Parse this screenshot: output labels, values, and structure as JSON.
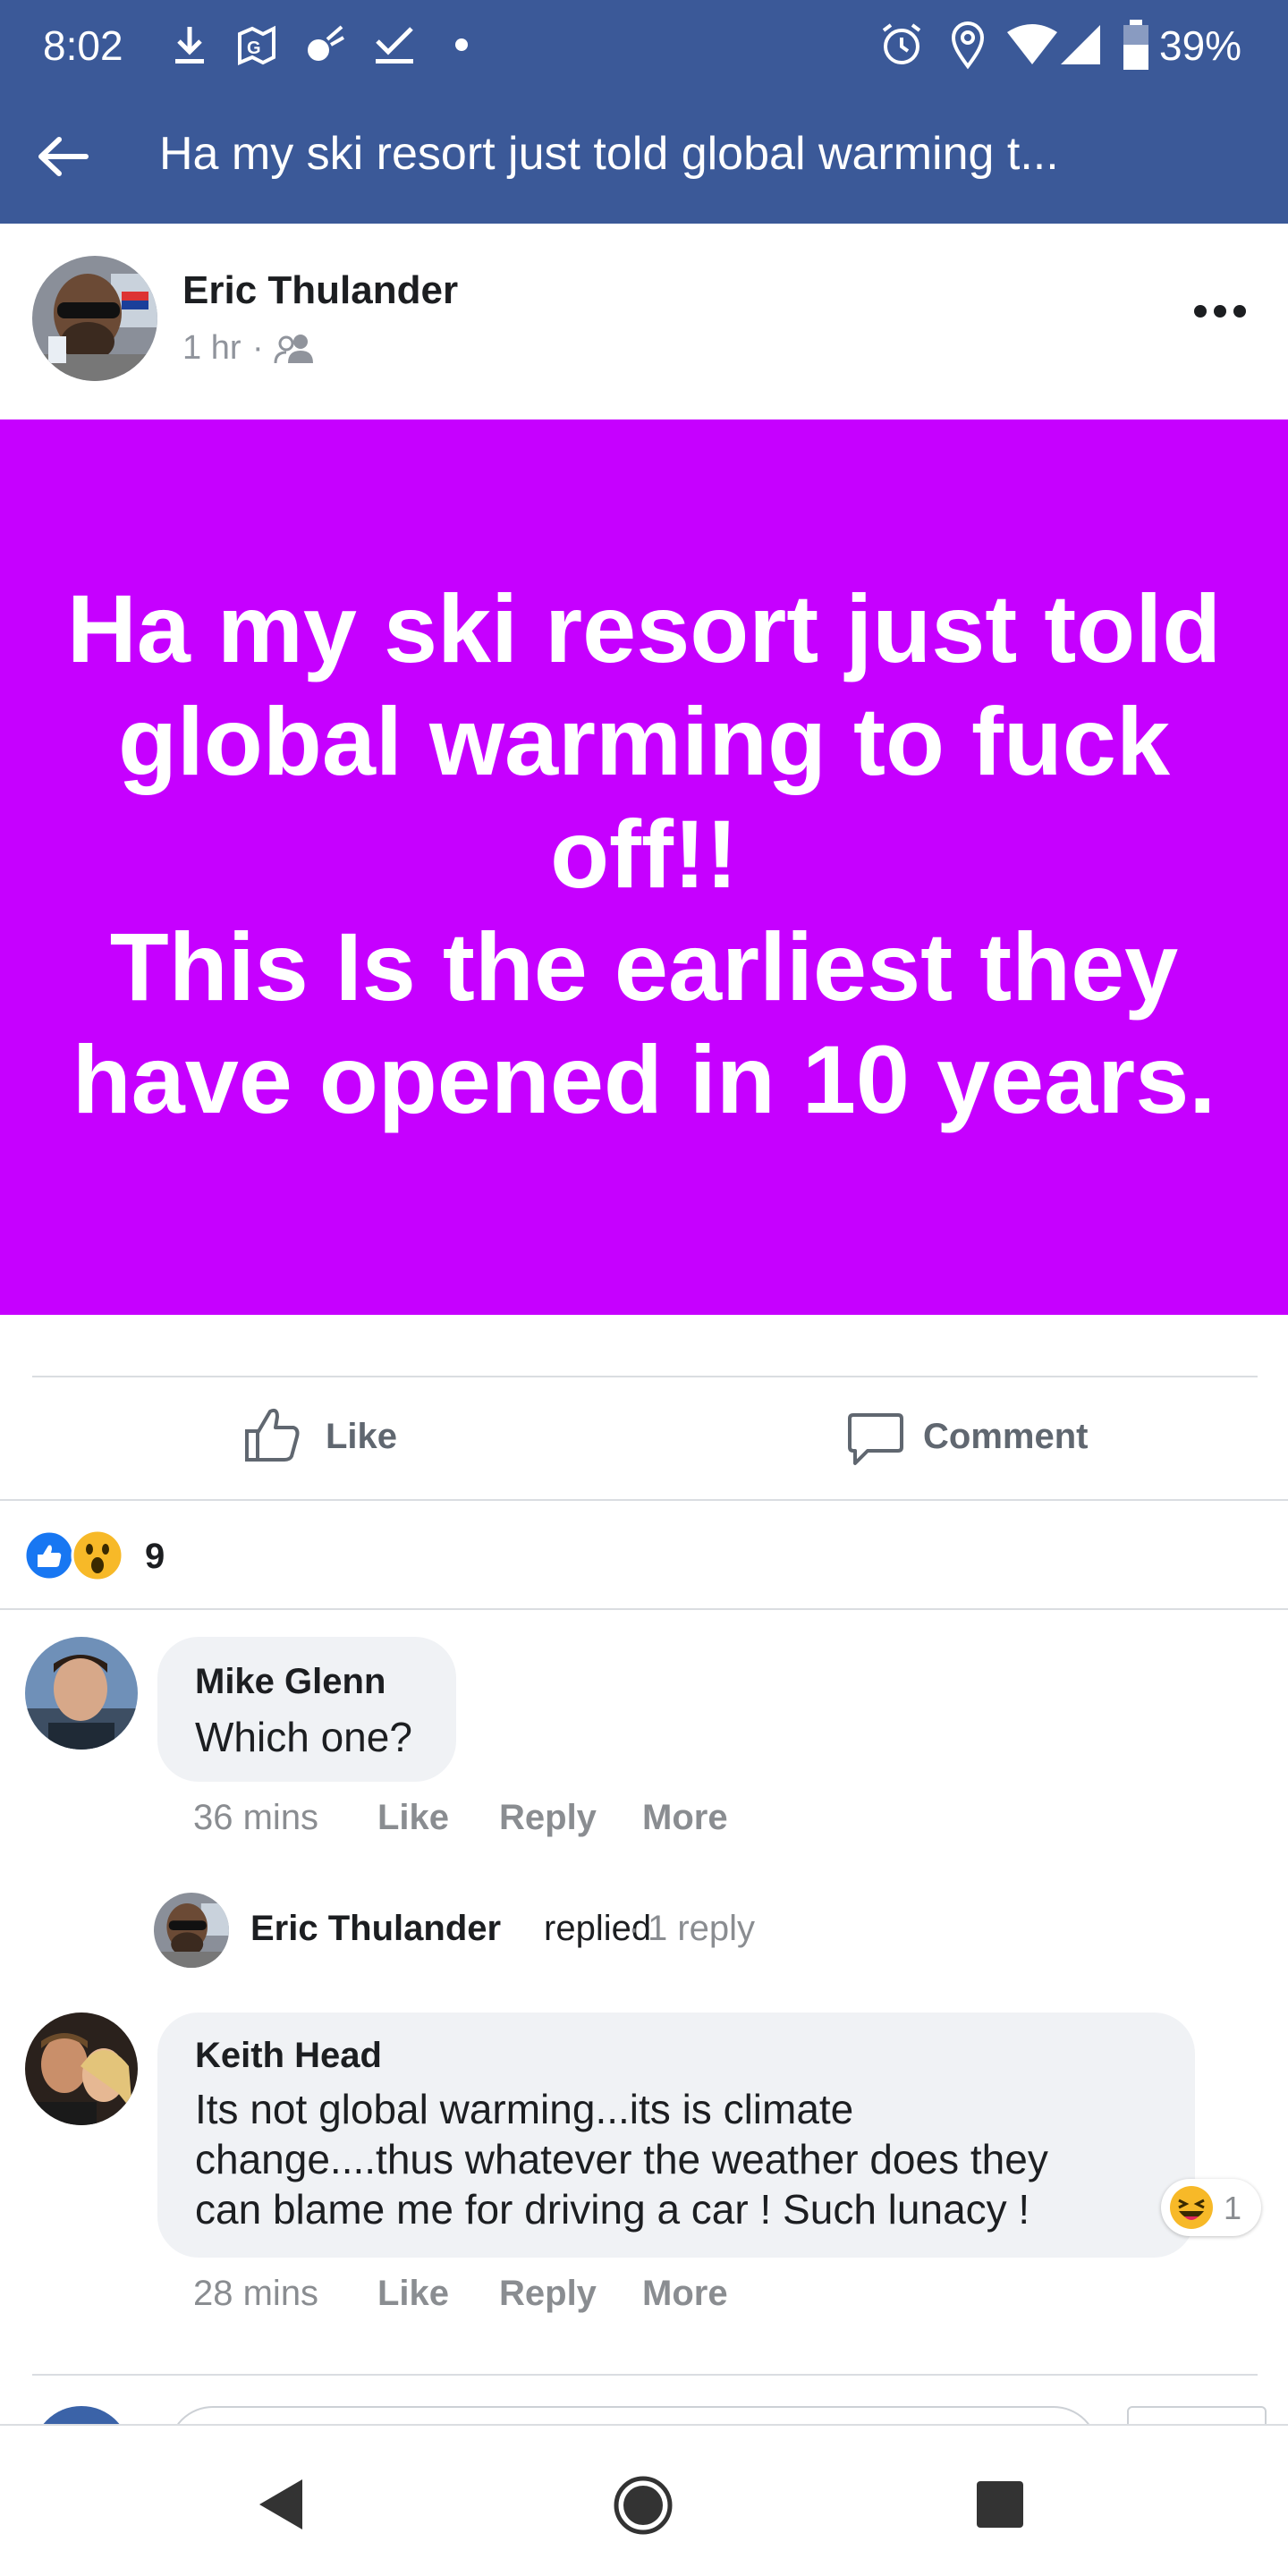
{
  "status_bar": {
    "time": "8:02",
    "battery": "39%",
    "icons": [
      "download-icon",
      "maps-icon",
      "notification-icon",
      "check-icon",
      "dot-icon",
      "alarm-icon",
      "location-icon",
      "wifi-icon",
      "signal-icon",
      "battery-icon"
    ]
  },
  "app_bar": {
    "back_icon": "arrow-left-icon",
    "title": "Ha my ski resort just told global warming t..."
  },
  "post": {
    "author": "Eric Thulander",
    "time": "1 hr",
    "separator": "·",
    "audience_icon": "friends-icon",
    "more_icon": "ellipsis-icon",
    "lines": [
      "Ha my ski resort just told",
      "global warming to fuck",
      "off!!",
      "This Is the earliest they",
      "have opened in 10 years."
    ],
    "background_color": "#c600ff"
  },
  "actions": {
    "like_label": "Like",
    "comment_label": "Comment"
  },
  "reactions": {
    "count": "9",
    "types": [
      "like-reaction-icon",
      "wow-reaction-icon"
    ]
  },
  "comments": [
    {
      "author": "Mike Glenn",
      "text": "Which one?",
      "time": "36 mins",
      "like": "Like",
      "reply": "Reply",
      "more": "More"
    },
    {
      "author": "Keith Head",
      "text_lines": [
        "Its not global warming...its is climate",
        "change....thus whatever the weather does they",
        "can blame me for driving a car ! Such lunacy !"
      ],
      "reaction_count": "1",
      "time": "28 mins",
      "like": "Like",
      "reply": "Reply",
      "more": "More"
    }
  ],
  "reply_summary": {
    "author": "Eric Thulander",
    "action": "replied",
    "separator": "·",
    "count": "1 reply"
  },
  "nav": {
    "icons": [
      "back-nav-icon",
      "home-nav-icon",
      "recents-nav-icon"
    ]
  },
  "colors": {
    "facebook_blue": "#3b5998",
    "post_purple": "#c600ff",
    "like_blue": "#1877f2",
    "wow_yellow": "#f7b928"
  }
}
